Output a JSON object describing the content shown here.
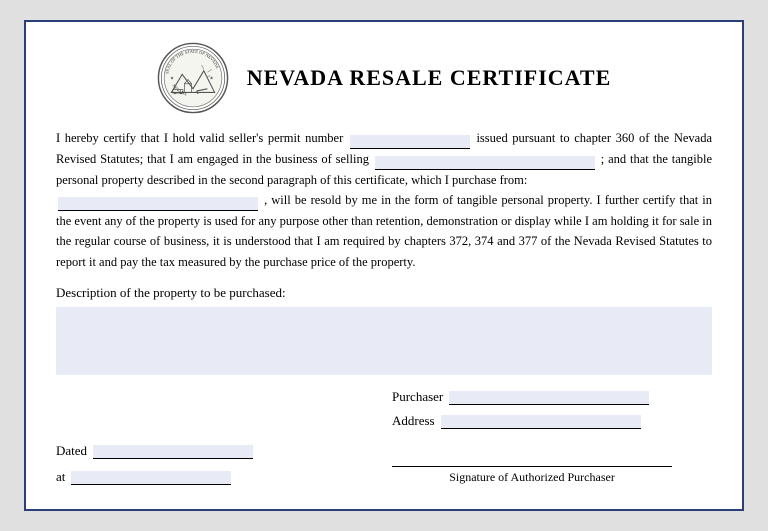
{
  "certificate": {
    "title": "NEVADA RESALE CERTIFICATE",
    "body_text_1": "I hereby certify that I hold valid seller's permit number",
    "body_text_2": "issued pursuant to chapter 360 of the Nevada Revised Statutes; that I am engaged in the business of selling",
    "body_text_3": "; and that the tangible personal property described in the second paragraph of this certificate, which I purchase from:",
    "body_text_4": ", will be resold by me in the form of tangible personal property. I further certify that in the event any of the property is used for any purpose other than retention, demonstration or display while I am holding it for sale in the regular course of business, it is understood that I am required by chapters 372, 374 and 377 of the Nevada Revised Statutes to report it and pay the tax measured by the purchase price of the property.",
    "description_label": "Description of the property to be purchased:",
    "dated_label": "Dated",
    "at_label": "at",
    "purchaser_label": "Purchaser",
    "address_label": "Address",
    "signature_label": "Signature of Authorized Purchaser"
  }
}
